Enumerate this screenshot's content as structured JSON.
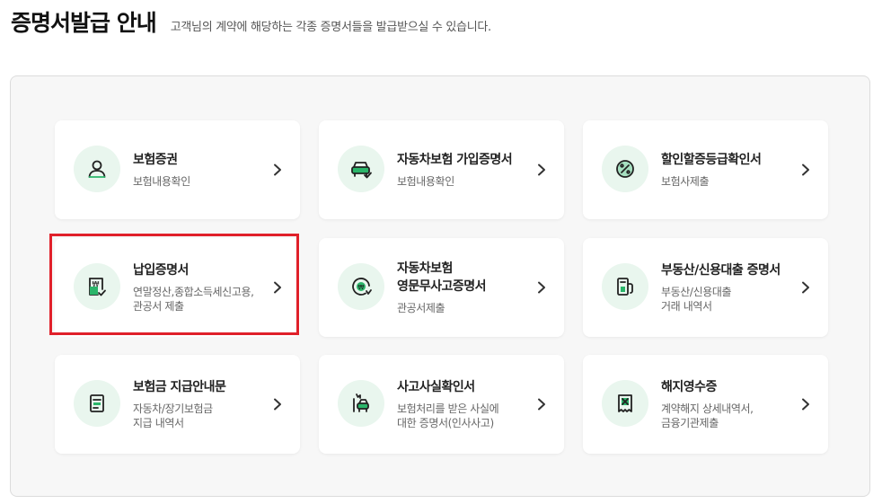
{
  "header": {
    "title": "증명서발급 안내",
    "subtitle": "고객님의 계약에 해당하는 각종 증명서들을 발급받으실 수 있습니다."
  },
  "colors": {
    "accent": "#2bb56a",
    "icon_bg": "#e9f6ee",
    "highlight": "#e0202a"
  },
  "cards": [
    {
      "title": "보험증권",
      "desc": "보험내용확인",
      "icon": "person-icon"
    },
    {
      "title": "자동차보험 가입증명서",
      "desc": "보험내용확인",
      "icon": "car-check-icon"
    },
    {
      "title": "할인할증등급확인서",
      "desc": "보험사제출",
      "icon": "percent-badge-icon"
    },
    {
      "title": "납입증명서",
      "desc": "연말정산,종합소득세신고용,\n관공서 제출",
      "icon": "won-document-icon",
      "highlighted": true
    },
    {
      "title": "자동차보험\n영문무사고증명서",
      "desc": "관공서제출",
      "icon": "globe-won-icon"
    },
    {
      "title": "부동산/신용대출 증명서",
      "desc": "부동산/신용대출\n거래 내역서",
      "icon": "building-icon"
    },
    {
      "title": "보험금 지급안내문",
      "desc": "자동차/장기보험금\n지급 내역서",
      "icon": "document-list-icon"
    },
    {
      "title": "사고사실확인서",
      "desc": "보험처리를 받은 사실에\n대한 증명서(인사사고)",
      "icon": "accident-car-icon"
    },
    {
      "title": "해지영수증",
      "desc": "계약해지 상세내역서,\n금융기관제출",
      "icon": "receipt-x-icon"
    }
  ]
}
